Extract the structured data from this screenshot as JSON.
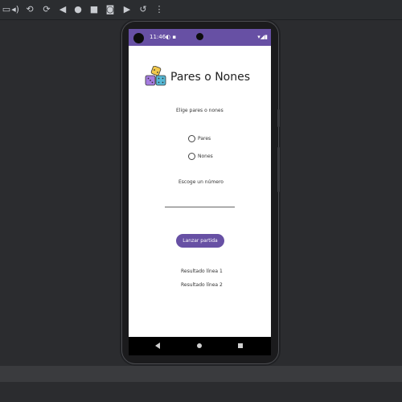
{
  "toolbar": {
    "icons": [
      "device-mirror-icon",
      "rotate-icon",
      "volume-up-icon",
      "volume-down-icon",
      "rotate-left-icon",
      "rotate-right-icon",
      "back-icon",
      "home-icon",
      "overview-icon",
      "screenshot-icon",
      "screen-record-icon",
      "snapshot-icon",
      "more-icon"
    ]
  },
  "status_bar": {
    "time": "11:46",
    "color": "#6750a4"
  },
  "app": {
    "title": "Pares o Nones",
    "choose_label": "Elige pares o nones",
    "options": [
      {
        "label": "Pares",
        "selected": false
      },
      {
        "label": "Nones",
        "selected": false
      }
    ],
    "number_label": "Escoge un número",
    "number_value": "",
    "button_label": "Lanzar partida",
    "result_line_1": "Resultado línea 1",
    "result_line_2": "Resultado línea 2",
    "accent_color": "#6750a4"
  }
}
